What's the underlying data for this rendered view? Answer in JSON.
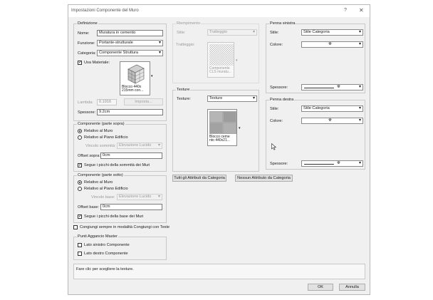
{
  "dialog": {
    "title": "Impostazioni Componente del Muro",
    "help": "?",
    "close": "✕"
  },
  "definition": {
    "legend": "Definizione",
    "name_label": "Nome:",
    "name_value": "Muratura in cemento",
    "function_label": "Funzione:",
    "function_value": "Portante-strutturale",
    "category_label": "Categoria:",
    "category_value": "Componente Struttura",
    "use_material_label": "Usa Materiale:",
    "use_material_checked": true,
    "material_tile_caption": "Blocco 440x\n215mm con...",
    "lambda_label": "Lambda:",
    "lambda_value": "0.1916",
    "settings_button": "Imposta...",
    "thickness_label": "Spessore:",
    "thickness_value": "9.2cm"
  },
  "upper": {
    "legend": "Componente (parte sopra)",
    "radio_wall": "Relativo al Muro",
    "radio_floor": "Relativo al Piano Edificio",
    "selected": "wall",
    "constraint_label": "Vincolo sommità:",
    "constraint_value": "Elevazione Lucido",
    "offset_label": "Offset sopra:",
    "offset_value": "0cm",
    "follow_label": "Segue i picchi della sommità dei Muri",
    "follow_checked": true
  },
  "lower": {
    "legend": "Componente (parte sotto)",
    "radio_wall": "Relativo al Muro",
    "radio_floor": "Relativo al Piano Edificio",
    "selected": "wall",
    "constraint_label": "Vincolo base:",
    "constraint_value": "Elevazione Lucido",
    "offset_label": "Offset base:",
    "offset_value": "0cm",
    "follow_label": "Segue i picchi della base dei Muri",
    "follow_checked": true
  },
  "join_label": "Congiungi sempre in modalità Congiungi con Teste",
  "anchor": {
    "legend": "Punti Aggancio Master",
    "left_label": "Lato sinistro Componente",
    "right_label": "Lato destro Componente"
  },
  "hatching": {
    "legend": "Riempimento",
    "style_label": "Stile:",
    "style_value": "Tratteggio",
    "hatch_label": "Tratteggio:",
    "tile_caption": "Componente\nCLS muratu..."
  },
  "texture": {
    "legend": "Texture",
    "label": "Texture:",
    "value": "Texture",
    "tile_caption": "Blocco ceme\nnto 440x21..."
  },
  "buttons": {
    "all_attributes": "Tutti gli Attributi da Categoria",
    "no_attributes": "Nessun Attributo da Categoria",
    "ok": "OK",
    "cancel": "Annulla"
  },
  "pen_left": {
    "legend": "Penna sinistra",
    "style_label": "Stile:",
    "style_value": "Stile Categoria",
    "color_label": "Colore:",
    "thickness_label": "Spessore:"
  },
  "pen_right": {
    "legend": "Penna destra",
    "style_label": "Stile:",
    "style_value": "Stile Categoria",
    "color_label": "Colore:",
    "thickness_label": "Spessore:"
  },
  "info_text": "Fare clic per scegliere la texture.",
  "icons": {
    "dropdown": "chevron-down-icon",
    "checkmark": "checkmark-icon",
    "paint_bucket": "paint-bucket-icon"
  }
}
